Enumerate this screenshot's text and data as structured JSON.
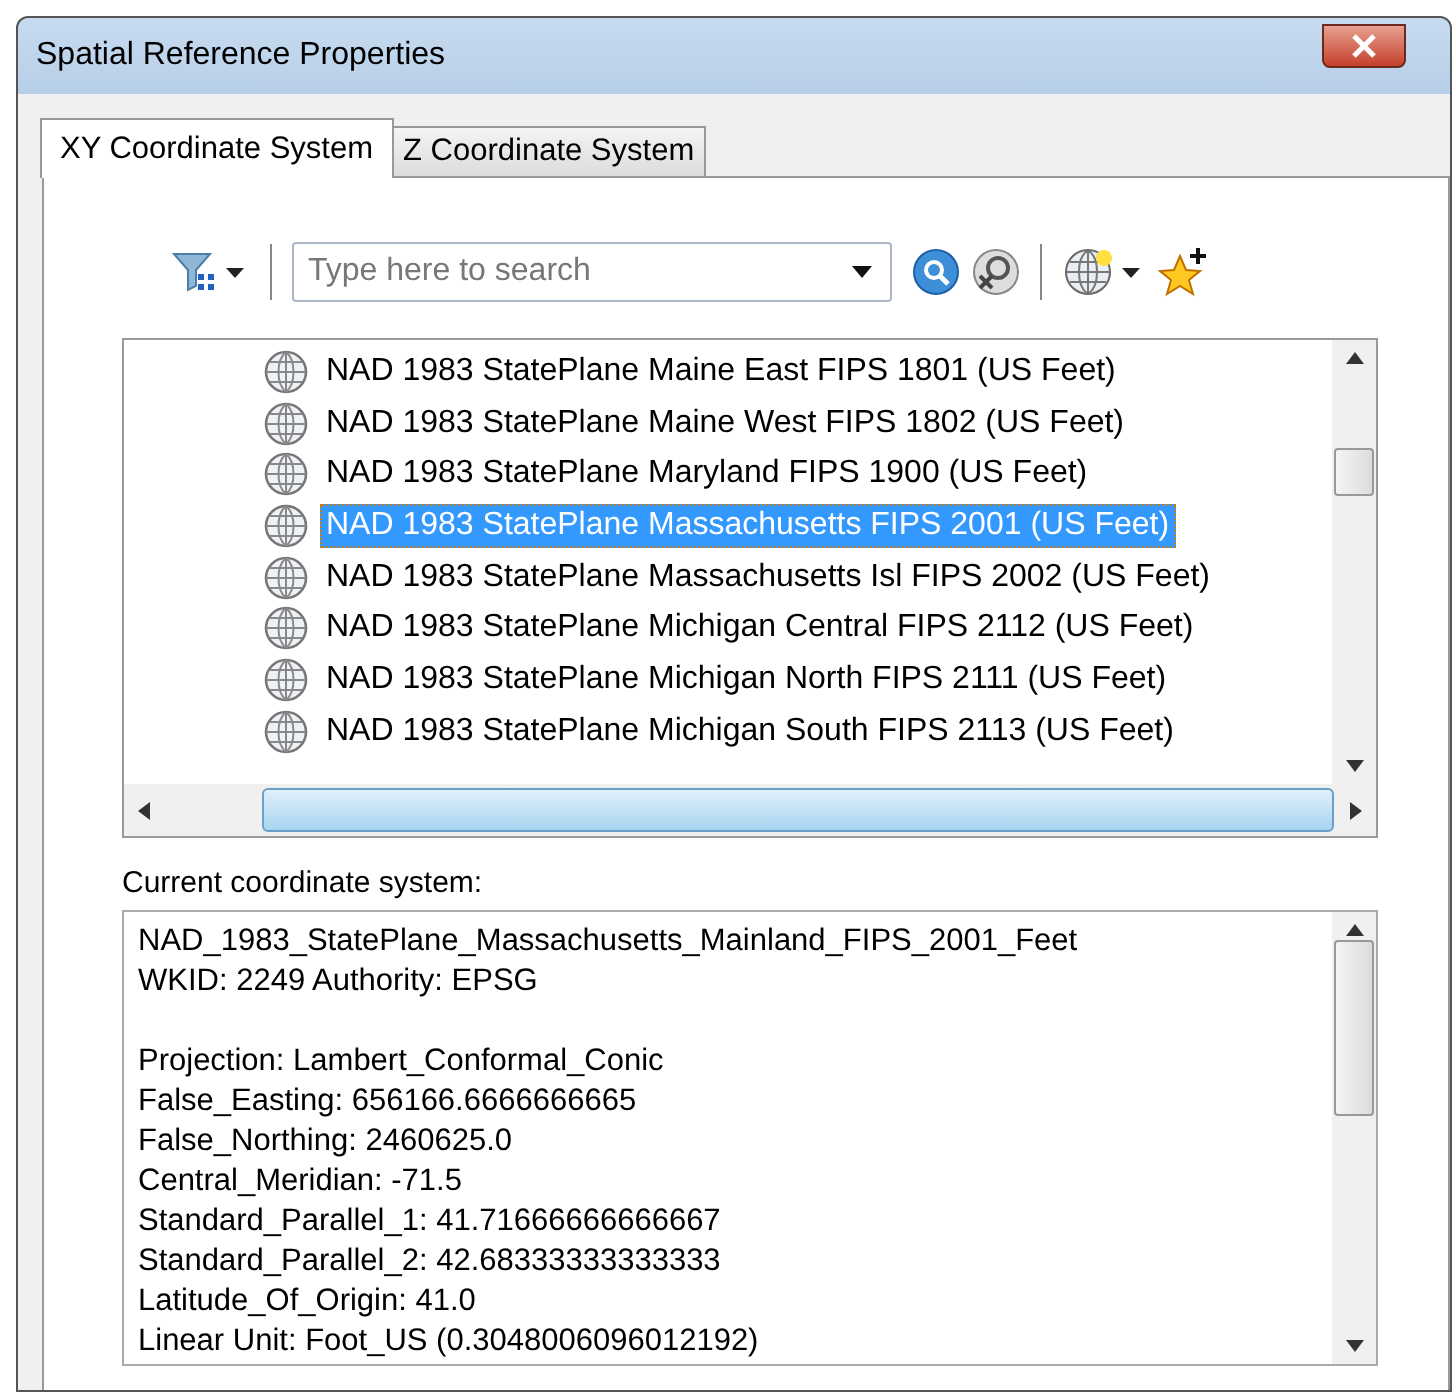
{
  "window": {
    "title": "Spatial Reference Properties"
  },
  "tabs": [
    {
      "label": "XY Coordinate System",
      "selected": true
    },
    {
      "label": "Z Coordinate System",
      "selected": false
    }
  ],
  "search": {
    "placeholder": "Type here to search"
  },
  "list": {
    "items": [
      {
        "label": "NAD 1983 StatePlane Maine East FIPS 1801 (US Feet)",
        "selected": false
      },
      {
        "label": "NAD 1983 StatePlane Maine West FIPS 1802 (US Feet)",
        "selected": false
      },
      {
        "label": "NAD 1983 StatePlane Maryland FIPS 1900 (US Feet)",
        "selected": false
      },
      {
        "label": "NAD 1983 StatePlane Massachusetts FIPS 2001 (US Feet)",
        "selected": true
      },
      {
        "label": "NAD 1983 StatePlane Massachusetts Isl FIPS 2002 (US Feet)",
        "selected": false
      },
      {
        "label": "NAD 1983 StatePlane Michigan Central FIPS 2112 (US Feet)",
        "selected": false
      },
      {
        "label": "NAD 1983 StatePlane Michigan North FIPS 2111 (US Feet)",
        "selected": false
      },
      {
        "label": "NAD 1983 StatePlane Michigan South FIPS 2113 (US Feet)",
        "selected": false
      }
    ]
  },
  "current": {
    "label": "Current coordinate system:",
    "paragraphs": [
      [
        "NAD_1983_StatePlane_Massachusetts_Mainland_FIPS_2001_Feet",
        "WKID: 2249 Authority: EPSG"
      ],
      [
        "Projection: Lambert_Conformal_Conic",
        "False_Easting: 656166.6666666665",
        "False_Northing: 2460625.0",
        "Central_Meridian: -71.5",
        "Standard_Parallel_1: 41.71666666666667",
        "Standard_Parallel_2: 42.68333333333333",
        "Latitude_Of_Origin: 41.0",
        "Linear Unit: Foot_US (0.3048006096012192)"
      ]
    ]
  }
}
